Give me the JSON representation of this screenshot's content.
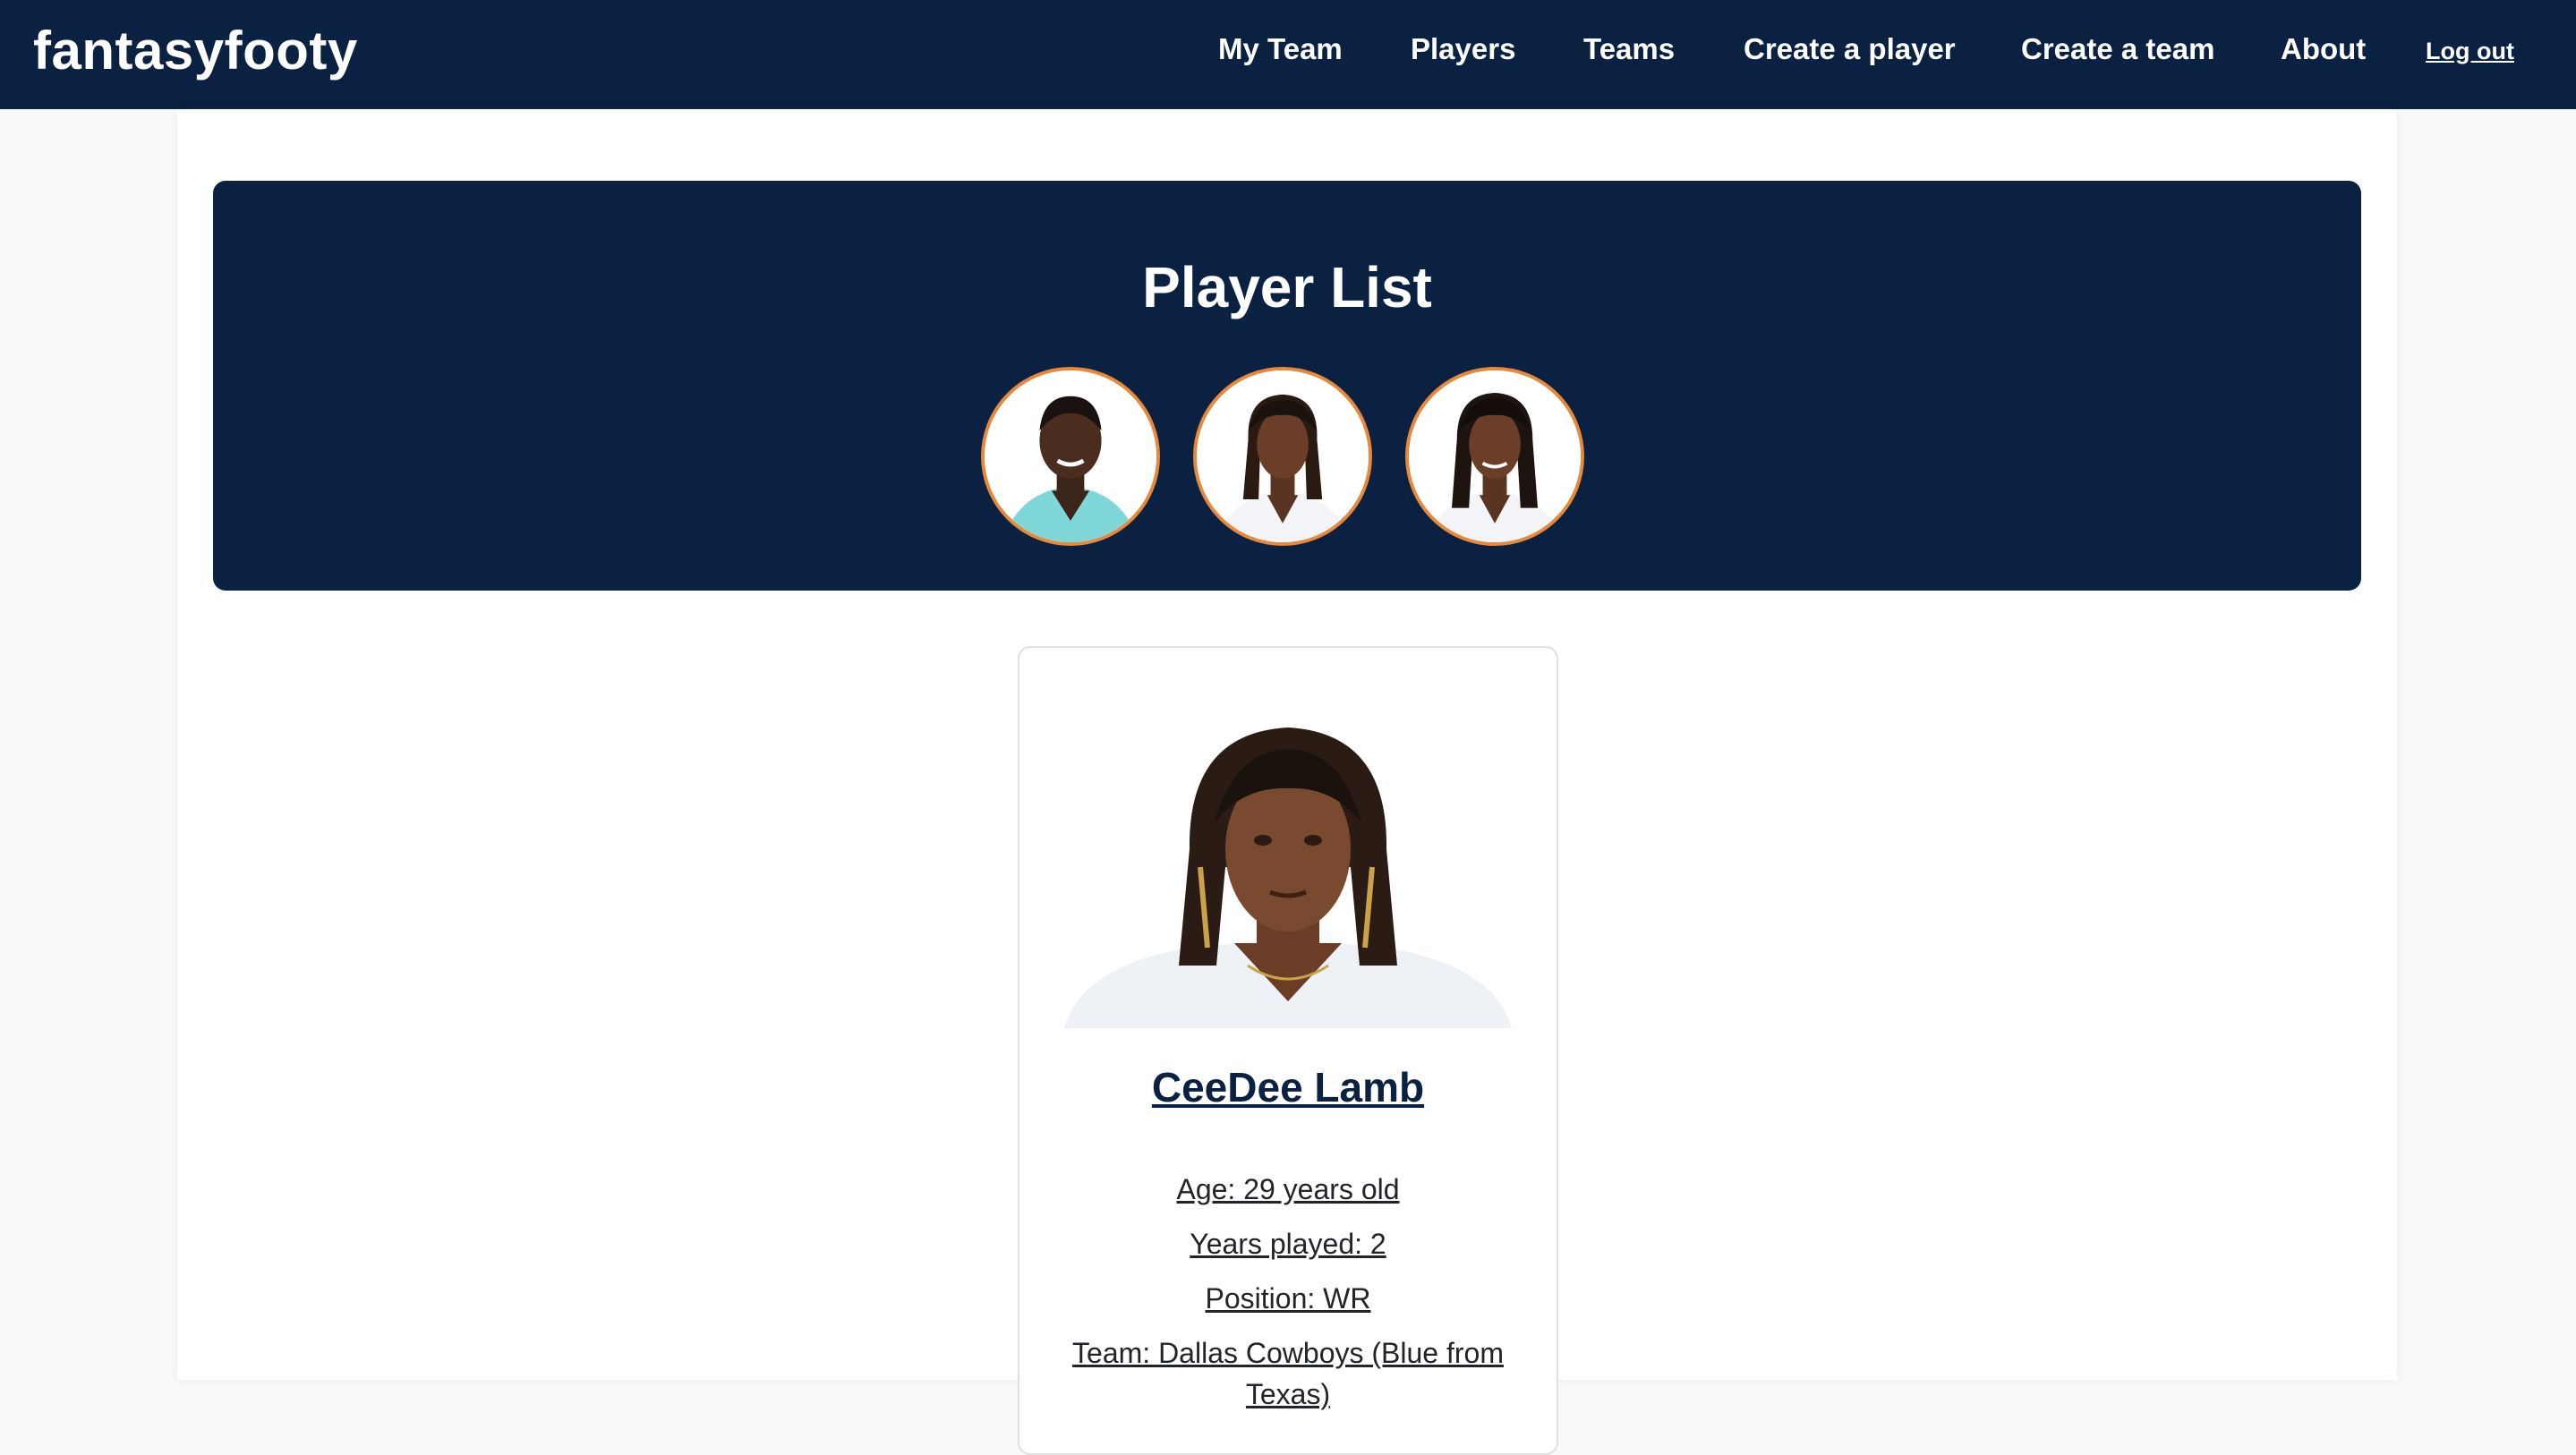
{
  "app": {
    "brand": "fantasyfooty"
  },
  "nav": {
    "items": [
      {
        "label": "My Team"
      },
      {
        "label": "Players"
      },
      {
        "label": "Teams"
      },
      {
        "label": "Create a player"
      },
      {
        "label": "Create a team"
      },
      {
        "label": "About"
      }
    ],
    "logout": "Log out"
  },
  "hero": {
    "title": "Player List",
    "avatars": [
      {
        "icon": "player-photo-1",
        "jersey_color": "#7fd6d8"
      },
      {
        "icon": "player-photo-2",
        "jersey_color": "#f2f4f7"
      },
      {
        "icon": "player-photo-3",
        "jersey_color": "#f2f4f7"
      }
    ]
  },
  "player_card": {
    "name": "CeeDee Lamb",
    "age": "Age: 29 years old",
    "years_played": "Years played: 2",
    "position": "Position: WR",
    "team_line1": "Team: Dallas Cowboys (Blue from",
    "team_line2": "Texas)"
  },
  "colors": {
    "navy": "#0a2142",
    "accent_orange": "#e8883a",
    "background": "#f8f9fa"
  }
}
